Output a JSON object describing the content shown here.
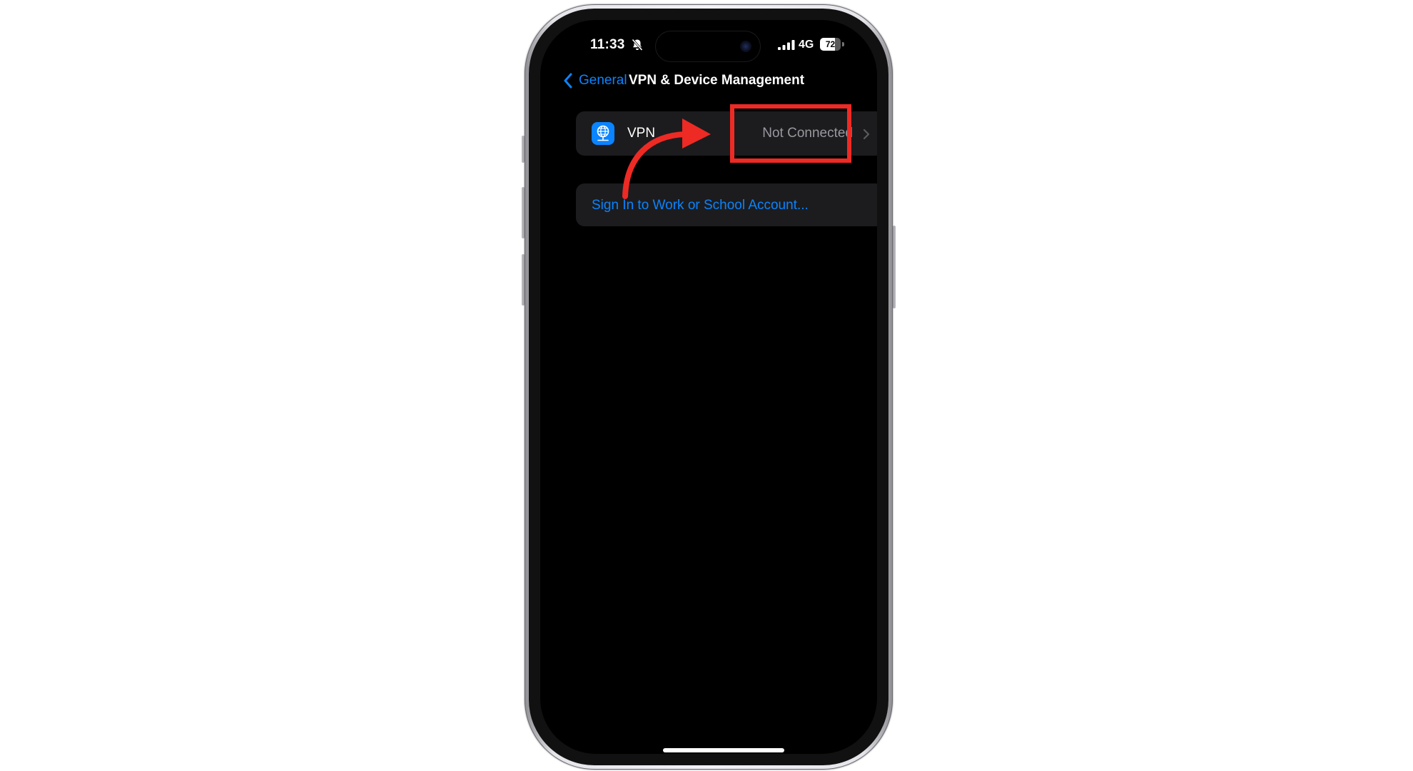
{
  "status_bar": {
    "time": "11:33",
    "network_type": "4G",
    "battery_percent": "72",
    "battery_fraction": 0.72,
    "icons": [
      "bell-slash-icon",
      "signal-icon",
      "battery-icon"
    ]
  },
  "nav": {
    "back_label": "General",
    "title": "VPN & Device Management"
  },
  "vpn_row": {
    "label": "VPN",
    "status": "Not Connected",
    "icon": "globe-vpn-icon"
  },
  "signin_row": {
    "label": "Sign In to Work or School Account..."
  },
  "colors": {
    "accent": "#0a84ff",
    "annotation": "#ee2a25",
    "cell_background": "#1c1c1e",
    "secondary_text": "#98989f"
  }
}
